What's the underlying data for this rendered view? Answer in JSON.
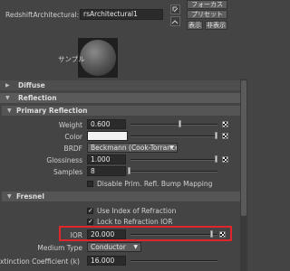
{
  "header": {
    "name_label": "RedshiftArchitectural:",
    "name_value": "rsArchitectural1",
    "focus_button": "フォーカス",
    "preset_button": "プリセット",
    "show_button": "表示",
    "hide_button": "非表示",
    "sample_label": "サンプル"
  },
  "sections": {
    "diffuse": "Diffuse",
    "reflection": "Reflection",
    "primary_reflection": "Primary Reflection",
    "fresnel": "Fresnel"
  },
  "primary_reflection": {
    "weight_label": "Weight",
    "weight_value": "0.600",
    "weight_level": 0.6,
    "color_label": "Color",
    "color_swatch": "#f2f2f2",
    "brdf_label": "BRDF",
    "brdf_value": "Beckmann (Cook-Torrance)",
    "glossiness_label": "Glossiness",
    "glossiness_value": "1.000",
    "glossiness_level": 1.0,
    "samples_label": "Samples",
    "samples_value": "8",
    "disable_bump_label": "Disable Prim. Refl. Bump Mapping",
    "disable_bump_checked": false
  },
  "fresnel": {
    "use_ior_label": "Use Index of Refraction",
    "use_ior_checked": true,
    "lock_ior_label": "Lock to Refraction IOR",
    "lock_ior_checked": true,
    "ior_label": "IOR",
    "ior_value": "20.000",
    "medium_type_label": "Medium Type",
    "medium_type_value": "Conductor",
    "extinction_label": "xtinction Coefficient (k)",
    "extinction_value": "16.000"
  },
  "colors": {
    "highlight": "#e0262b",
    "panel_bg": "#444444",
    "section_bg": "#5a5a5a"
  }
}
